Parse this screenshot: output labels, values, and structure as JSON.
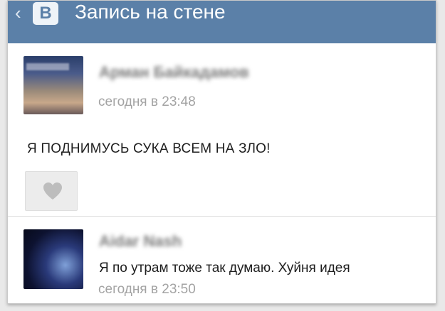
{
  "header": {
    "back_icon": "chevron-left-icon",
    "logo_letter": "В",
    "title": "Запись на стене"
  },
  "post": {
    "author": "Арман Байкадамов",
    "time": "сегодня в 23:48",
    "text": "Я ПОДНИМУСЬ СУКА ВСЕМ НА ЗЛО!",
    "like_icon": "heart-icon"
  },
  "comment": {
    "author": "Aidar Nash",
    "text": "Я по утрам тоже так думаю. Хуйня идея",
    "time": "сегодня в 23:50"
  },
  "colors": {
    "header_bg": "#5b80a8",
    "timestamp": "#a3a3a3",
    "text": "#1e1e1e"
  }
}
